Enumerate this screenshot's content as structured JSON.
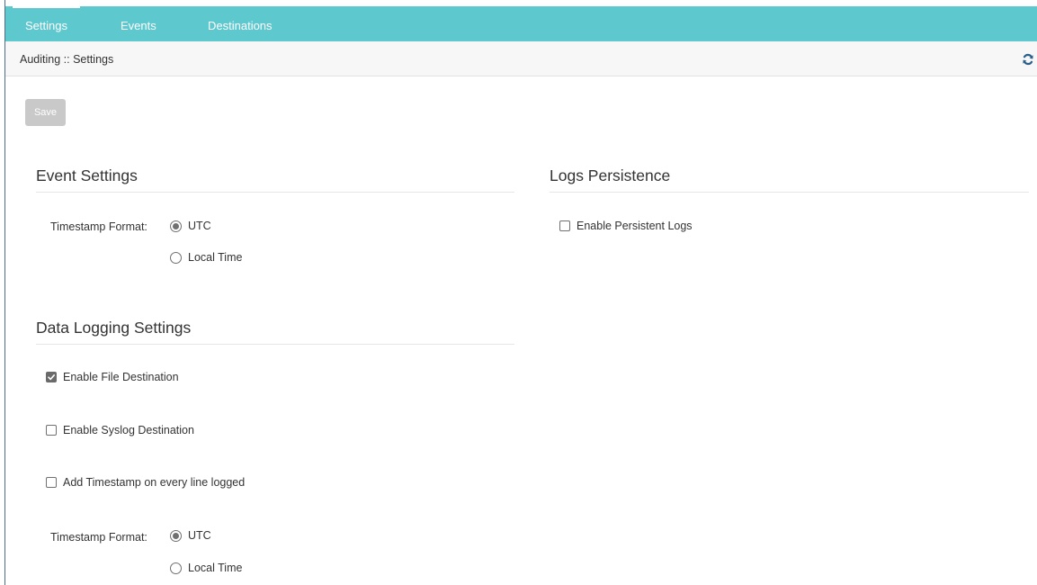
{
  "nav": {
    "tabs": [
      {
        "label": "Settings",
        "active": true
      },
      {
        "label": "Events",
        "active": false
      },
      {
        "label": "Destinations",
        "active": false
      }
    ]
  },
  "breadcrumb": "Auditing :: Settings",
  "toolbar": {
    "save_label": "Save",
    "refresh_icon": "refresh-icon"
  },
  "event_settings": {
    "title": "Event Settings",
    "timestamp_label": "Timestamp Format:",
    "options": [
      {
        "label": "UTC",
        "selected": true
      },
      {
        "label": "Local Time",
        "selected": false
      }
    ]
  },
  "logs_persistence": {
    "title": "Logs Persistence",
    "enable_persistent_label": "Enable Persistent Logs",
    "enable_persistent_checked": false
  },
  "data_logging": {
    "title": "Data Logging Settings",
    "checkboxes": [
      {
        "label": "Enable File Destination",
        "checked": true
      },
      {
        "label": "Enable Syslog Destination",
        "checked": false
      },
      {
        "label": "Add Timestamp on every line logged",
        "checked": false
      }
    ],
    "timestamp_label": "Timestamp Format:",
    "options": [
      {
        "label": "UTC",
        "selected": true
      },
      {
        "label": "Local Time",
        "selected": false
      }
    ]
  },
  "colors": {
    "nav_bg": "#5ec8cf",
    "breadcrumb_bg": "#f7f7f7",
    "save_disabled_bg": "#c9c9c9",
    "refresh_icon": "#2b5f8a"
  }
}
